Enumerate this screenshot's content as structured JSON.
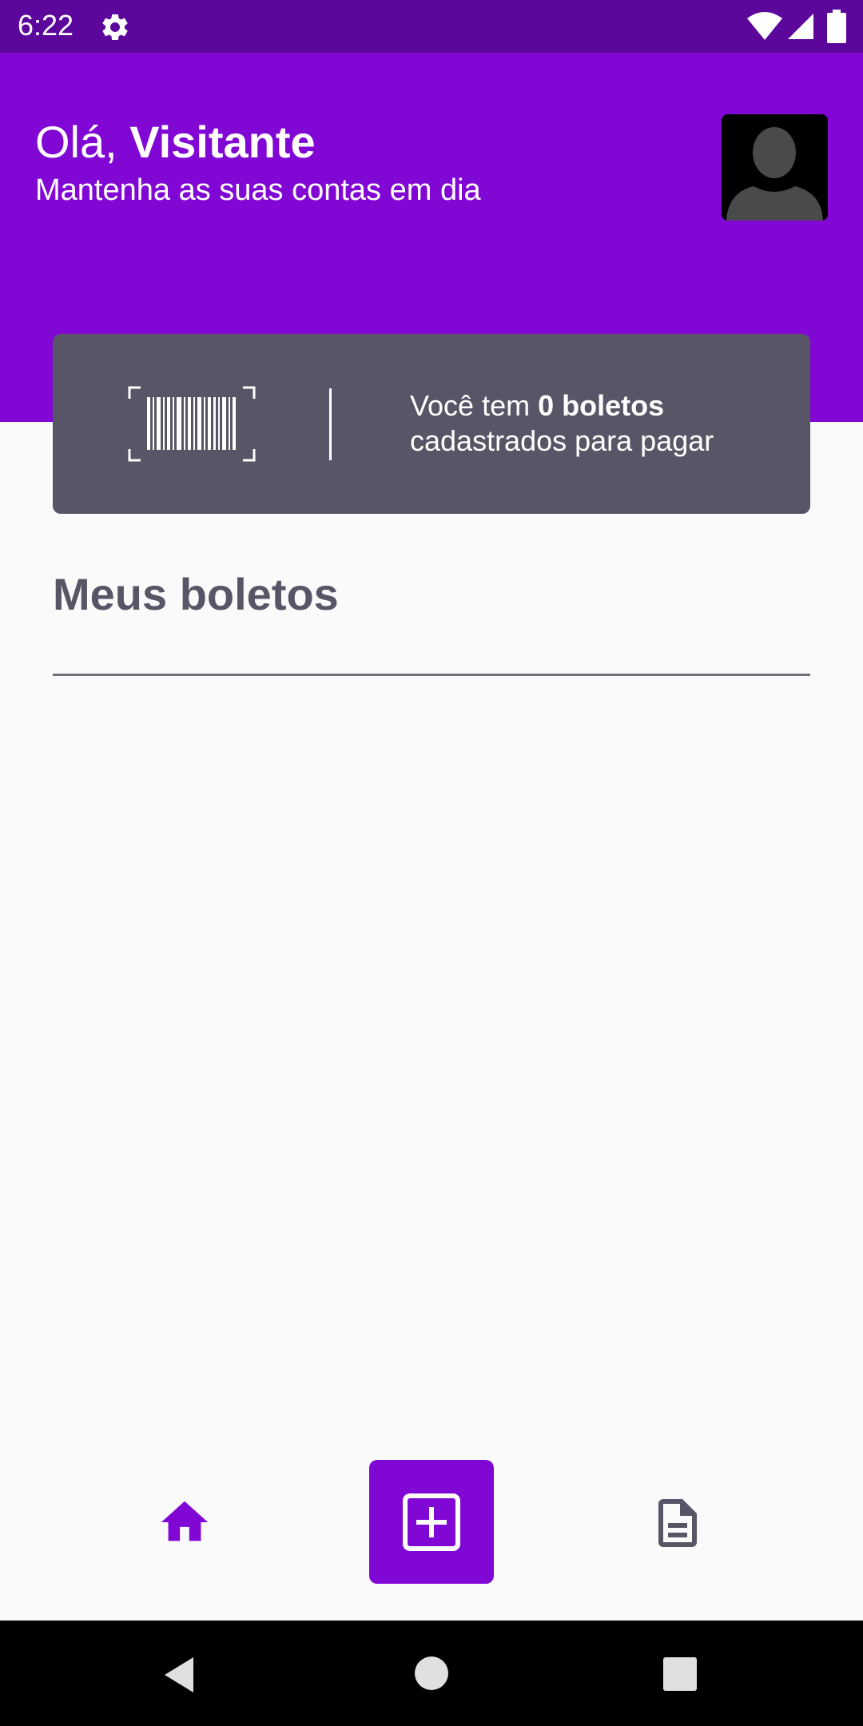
{
  "status_bar": {
    "time": "6:22",
    "icons": [
      "gear-icon",
      "wifi-icon",
      "signal-icon",
      "battery-icon"
    ]
  },
  "header": {
    "greeting_prefix": "Olá, ",
    "user_name": "Visitante",
    "subtitle": "Mantenha as suas contas em dia",
    "avatar_icon": "avatar-silhouette-icon"
  },
  "summary_card": {
    "icon": "barcode-scan-icon",
    "text_prefix": "Você tem ",
    "count_text": "0 boletos",
    "text_suffix": "cadastrados para pagar"
  },
  "section": {
    "title": "Meus boletos"
  },
  "bottom_nav": {
    "items": [
      {
        "icon": "home-icon",
        "active": true
      },
      {
        "icon": "add-box-icon",
        "active": false
      },
      {
        "icon": "document-icon",
        "active": false
      }
    ]
  },
  "system_nav": {
    "icons": [
      "back-icon",
      "home-circle-icon",
      "recents-icon"
    ]
  },
  "colors": {
    "status_bar": "#5c079b",
    "primary": "#8007d4",
    "card": "#585666",
    "heading": "#585666",
    "background": "#fafafa",
    "divider": "#706e7a",
    "inactive_icon": "#585666"
  }
}
